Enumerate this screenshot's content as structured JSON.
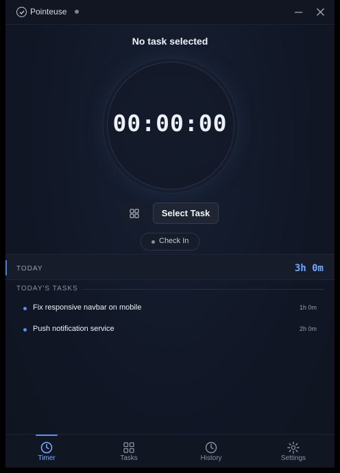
{
  "window": {
    "app_title": "Pointeuse"
  },
  "timer": {
    "task_title": "No task selected",
    "display": "00:00:00",
    "select_task_label": "Select Task",
    "check_in_label": "Check In"
  },
  "today": {
    "label": "TODAY",
    "total": "3h 0m"
  },
  "tasks": {
    "heading": "TODAY'S TASKS",
    "items": [
      {
        "name": "Fix responsive navbar on mobile",
        "time": "1h 0m"
      },
      {
        "name": "Push notification service",
        "time": "2h 0m"
      }
    ]
  },
  "tabs": [
    {
      "label": "Timer",
      "icon": "clock-icon",
      "active": true
    },
    {
      "label": "Tasks",
      "icon": "grid-icon",
      "active": false
    },
    {
      "label": "History",
      "icon": "history-icon",
      "active": false
    },
    {
      "label": "Settings",
      "icon": "gear-icon",
      "active": false
    }
  ],
  "colors": {
    "accent": "#5b8ef0",
    "total": "#6fa8ff",
    "background": "#111726"
  }
}
